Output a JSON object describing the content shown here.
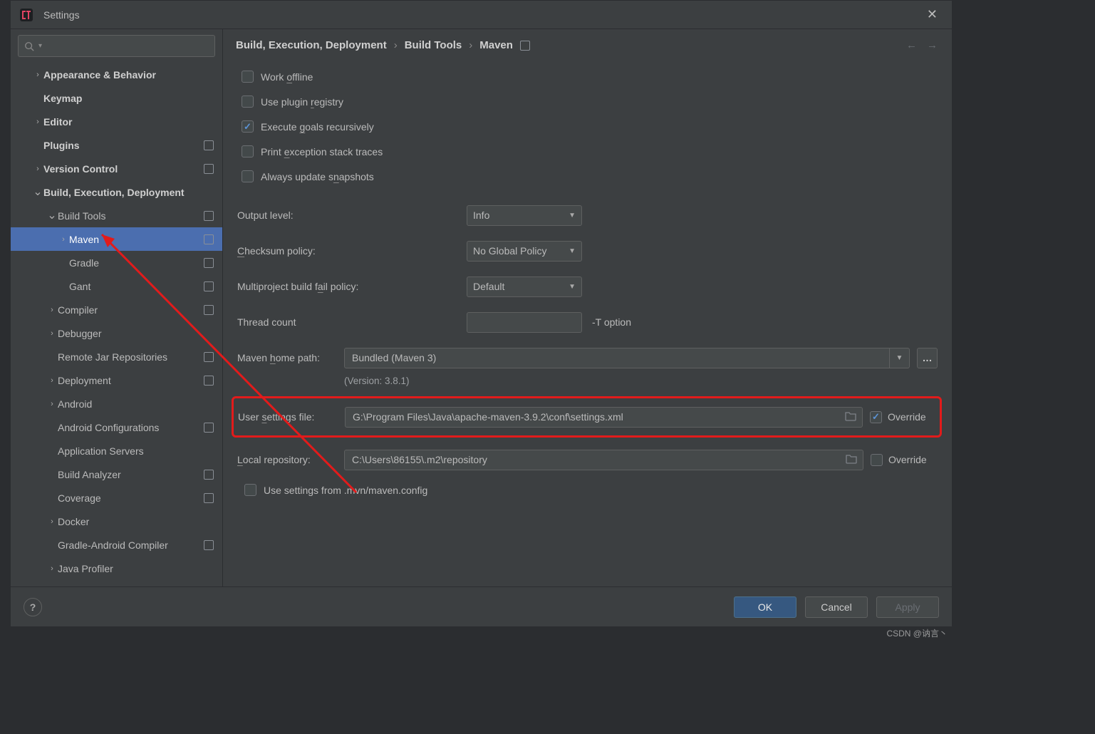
{
  "window": {
    "title": "Settings"
  },
  "search": {
    "placeholder": ""
  },
  "tree": {
    "items": [
      {
        "label": "Appearance & Behavior",
        "indent": 1,
        "arrow": "right",
        "bold": true
      },
      {
        "label": "Keymap",
        "indent": 1,
        "arrow": "",
        "bold": true
      },
      {
        "label": "Editor",
        "indent": 1,
        "arrow": "right",
        "bold": true
      },
      {
        "label": "Plugins",
        "indent": 1,
        "arrow": "",
        "bold": true,
        "badge": true
      },
      {
        "label": "Version Control",
        "indent": 1,
        "arrow": "right",
        "bold": true,
        "badge": true
      },
      {
        "label": "Build, Execution, Deployment",
        "indent": 1,
        "arrow": "down",
        "bold": true
      },
      {
        "label": "Build Tools",
        "indent": 2,
        "arrow": "down",
        "badge": true
      },
      {
        "label": "Maven",
        "indent": 3,
        "arrow": "right",
        "badge": true,
        "selected": true
      },
      {
        "label": "Gradle",
        "indent": 3,
        "arrow": "",
        "badge": true
      },
      {
        "label": "Gant",
        "indent": 3,
        "arrow": "",
        "badge": true
      },
      {
        "label": "Compiler",
        "indent": 2,
        "arrow": "right",
        "badge": true
      },
      {
        "label": "Debugger",
        "indent": 2,
        "arrow": "right"
      },
      {
        "label": "Remote Jar Repositories",
        "indent": 2,
        "arrow": "",
        "badge": true
      },
      {
        "label": "Deployment",
        "indent": 2,
        "arrow": "right",
        "badge": true
      },
      {
        "label": "Android",
        "indent": 2,
        "arrow": "right"
      },
      {
        "label": "Android Configurations",
        "indent": 2,
        "arrow": "",
        "badge": true
      },
      {
        "label": "Application Servers",
        "indent": 2,
        "arrow": ""
      },
      {
        "label": "Build Analyzer",
        "indent": 2,
        "arrow": "",
        "badge": true
      },
      {
        "label": "Coverage",
        "indent": 2,
        "arrow": "",
        "badge": true
      },
      {
        "label": "Docker",
        "indent": 2,
        "arrow": "right"
      },
      {
        "label": "Gradle-Android Compiler",
        "indent": 2,
        "arrow": "",
        "badge": true
      },
      {
        "label": "Java Profiler",
        "indent": 2,
        "arrow": "right"
      }
    ]
  },
  "breadcrumb": {
    "a": "Build, Execution, Deployment",
    "b": "Build Tools",
    "c": "Maven"
  },
  "checks": {
    "work_offline": "Work offline",
    "plugin_registry": "Use plugin registry",
    "exec_goals": "Execute goals recursively",
    "print_exc": "Print exception stack traces",
    "always_update": "Always update snapshots",
    "use_mvn_config": "Use settings from .mvn/maven.config"
  },
  "fields": {
    "output_level": {
      "label": "Output level:",
      "value": "Info"
    },
    "checksum": {
      "label": "Checksum policy:",
      "value": "No Global Policy"
    },
    "fail_policy": {
      "label": "Multiproject build fail policy:",
      "value": "Default"
    },
    "thread_count": {
      "label": "Thread count",
      "value": "",
      "aux": "-T option"
    },
    "home_path": {
      "label": "Maven home path:",
      "value": "Bundled (Maven 3)"
    },
    "version_note": "(Version: 3.8.1)",
    "user_settings": {
      "label": "User settings file:",
      "value": "G:\\Program Files\\Java\\apache-maven-3.9.2\\conf\\settings.xml",
      "override": "Override",
      "override_checked": true
    },
    "local_repo": {
      "label": "Local repository:",
      "value": "C:\\Users\\86155\\.m2\\repository",
      "override": "Override",
      "override_checked": false
    }
  },
  "footer": {
    "ok": "OK",
    "cancel": "Cancel",
    "apply": "Apply"
  },
  "watermark": "CSDN @讷言丶"
}
